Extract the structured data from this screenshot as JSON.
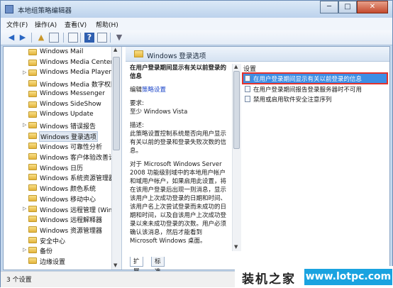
{
  "window": {
    "title": "本地组策略编辑器",
    "minimize": "─",
    "maximize": "□",
    "close": "✕"
  },
  "menu": [
    "文件(F)",
    "操作(A)",
    "查看(V)",
    "帮助(H)"
  ],
  "tree": {
    "items": [
      {
        "label": "Windows Mail",
        "arrow": ""
      },
      {
        "label": "Windows Media Center",
        "arrow": ""
      },
      {
        "label": "Windows Media Player",
        "arrow": "▷"
      },
      {
        "label": "Windows Media 数字权限",
        "arrow": ""
      },
      {
        "label": "Windows Messenger",
        "arrow": ""
      },
      {
        "label": "Windows SideShow",
        "arrow": ""
      },
      {
        "label": "Windows Update",
        "arrow": ""
      },
      {
        "label": "Windows 错误报告",
        "arrow": "▷"
      },
      {
        "label": "Windows 登录选项",
        "arrow": "",
        "selected": true
      },
      {
        "label": "Windows 可靠性分析",
        "arrow": ""
      },
      {
        "label": "Windows 客户体验改善计",
        "arrow": ""
      },
      {
        "label": "Windows 日历",
        "arrow": ""
      },
      {
        "label": "Windows 系统资源管理器",
        "arrow": ""
      },
      {
        "label": "Windows 颜色系统",
        "arrow": ""
      },
      {
        "label": "Windows 移动中心",
        "arrow": ""
      },
      {
        "label": "Windows 远程管理 (WinR",
        "arrow": "▷"
      },
      {
        "label": "Windows 远程解释器",
        "arrow": ""
      },
      {
        "label": "Windows 资源管理器",
        "arrow": ""
      },
      {
        "label": "安全中心",
        "arrow": ""
      },
      {
        "label": "备份",
        "arrow": "▷"
      },
      {
        "label": "边缘设置",
        "arrow": ""
      }
    ]
  },
  "right": {
    "header": "Windows 登录选项",
    "desc": {
      "title": "在用户登录期间显示有关以前登录的信息",
      "edit_prefix": "编辑",
      "edit_link": "策略设置",
      "req_label": "要求:",
      "req_value": "至少 Windows Vista",
      "desc_label": "描述:",
      "desc_text": "此策略设置控制系统是否向用户显示有关以前的登录和登录失败次数的信息。",
      "more_text": "对于 Microsoft Windows Server 2008 功能级别域中的本地用户帐户和域用户帐户，如果启用此设置，将在该用户登录后出现一则消息，显示该用户上次成功登录的日期和时间、该用户名上次尝试登录而未成功的日期和时间，以及自该用户上次成功登录以来未成功登录的次数。用户必须确认该消息，然后才能看到 Microsoft Windows 桌面。"
    },
    "settings_head": "设置",
    "settings": [
      "在用户登录期间显示有关以前登录的信息",
      "在用户登录期间报告登录服务器时不可用",
      "禁用或启用软件安全注意序列"
    ],
    "tabs": [
      "扩展",
      "标准"
    ]
  },
  "status": {
    "text": "3 个设置"
  },
  "watermark": {
    "cn": "装机之家",
    "url": "www.lotpc.com"
  }
}
